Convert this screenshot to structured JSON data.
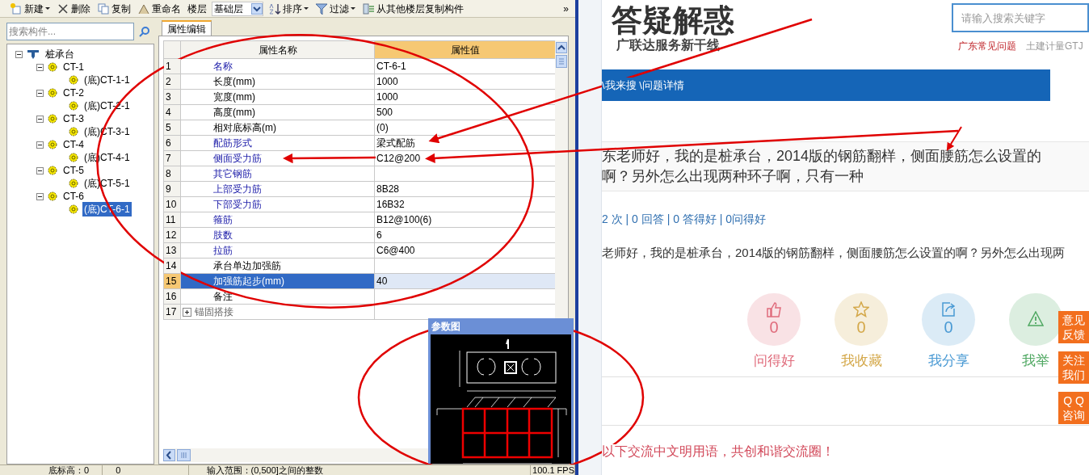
{
  "app": {
    "toolbar": [
      {
        "kind": "button",
        "label": "新建",
        "caret": true
      },
      {
        "kind": "button",
        "label": "删除",
        "caret": false
      },
      {
        "kind": "button",
        "label": "复制",
        "caret": false
      },
      {
        "kind": "button",
        "label": "重命名",
        "caret": false
      },
      {
        "kind": "label",
        "label": "楼层"
      },
      {
        "kind": "dropdown",
        "label": "基础层"
      },
      {
        "kind": "button",
        "label": "排序",
        "caret": true
      },
      {
        "kind": "button",
        "label": "过滤",
        "caret": true
      },
      {
        "kind": "button",
        "label": "从其他楼层复制构件",
        "caret": false
      },
      {
        "kind": "more",
        "label": "»"
      }
    ],
    "search": {
      "placeholder": "搜索构件..."
    },
    "tree": [
      {
        "label": "桩承台",
        "expanded": true,
        "selected": false,
        "children": [
          {
            "label": "CT-1",
            "expanded": true,
            "selected": false,
            "children": [
              {
                "label": "(底)CT-1-1",
                "selected": false
              }
            ]
          },
          {
            "label": "CT-2",
            "expanded": true,
            "selected": false,
            "children": [
              {
                "label": "(底)CT-2-1",
                "selected": false
              }
            ]
          },
          {
            "label": "CT-3",
            "expanded": true,
            "selected": false,
            "children": [
              {
                "label": "(底)CT-3-1",
                "selected": false
              }
            ]
          },
          {
            "label": "CT-4",
            "expanded": true,
            "selected": false,
            "children": [
              {
                "label": "(底)CT-4-1",
                "selected": false
              }
            ]
          },
          {
            "label": "CT-5",
            "expanded": true,
            "selected": false,
            "children": [
              {
                "label": "(底)CT-5-1",
                "selected": false
              }
            ]
          },
          {
            "label": "CT-6",
            "expanded": true,
            "selected": false,
            "children": [
              {
                "label": "(底)CT-6-1",
                "selected": true
              }
            ]
          }
        ]
      }
    ],
    "tabs": [
      {
        "label": "属性编辑",
        "selected": true
      }
    ],
    "table": {
      "columns": [
        "属性名称",
        "属性值"
      ],
      "rows": [
        {
          "index": "1",
          "name": "名称",
          "value": "CT-6-1",
          "kind": "blue",
          "selected": false
        },
        {
          "index": "2",
          "name": "长度(mm)",
          "value": "1000",
          "kind": "plain",
          "selected": false
        },
        {
          "index": "3",
          "name": "宽度(mm)",
          "value": "1000",
          "kind": "plain",
          "selected": false
        },
        {
          "index": "4",
          "name": "高度(mm)",
          "value": "500",
          "kind": "plain",
          "selected": false
        },
        {
          "index": "5",
          "name": "相对底标高(m)",
          "value": "(0)",
          "kind": "plain",
          "selected": false
        },
        {
          "index": "6",
          "name": "配筋形式",
          "value": "梁式配筋",
          "kind": "blue",
          "selected": false
        },
        {
          "index": "7",
          "name": "侧面受力筋",
          "value": "C12@200",
          "kind": "blue",
          "selected": false
        },
        {
          "index": "8",
          "name": "其它钢筋",
          "kind": "blue",
          "selected": false
        },
        {
          "index": "9",
          "name": "上部受力筋",
          "value": "8B28",
          "kind": "blue",
          "selected": false
        },
        {
          "index": "10",
          "name": "下部受力筋",
          "value": "16B32",
          "kind": "blue",
          "selected": false
        },
        {
          "index": "11",
          "name": "箍筋",
          "value": "B12@100(6)",
          "kind": "blue",
          "selected": false
        },
        {
          "index": "12",
          "name": "肢数",
          "value": "6",
          "kind": "blue",
          "selected": false
        },
        {
          "index": "13",
          "name": "拉筋",
          "value": "C6@400",
          "kind": "blue",
          "selected": false
        },
        {
          "index": "14",
          "name": "承台单边加强筋",
          "kind": "plain",
          "selected": false
        },
        {
          "index": "15",
          "name": "加强筋起步(mm)",
          "value": "40",
          "kind": "plain",
          "selected": true
        },
        {
          "index": "16",
          "name": "备注",
          "kind": "plain",
          "selected": false
        },
        {
          "index": "17",
          "name": "锚固搭接",
          "kind": "group",
          "expanded": false,
          "selected": false
        }
      ]
    },
    "diagram_panel": {
      "title": "参数图"
    },
    "status_bar": [
      "底标高：0",
      "0",
      "输入范围：(0,500]之间的整数",
      "100.1 FPS"
    ]
  },
  "web": {
    "logo": {
      "title": "答疑解惑",
      "subtitle": "广联达服务新干线"
    },
    "search": {
      "placeholder": "请输入搜索关键字"
    },
    "header_links": [
      {
        "label": "广东常见问题",
        "kind": "hot"
      },
      {
        "label": "土建计量GTJ",
        "kind": "normal"
      }
    ],
    "breadcrumb": "\\我来搜 \\问题详情",
    "question_title": "东老师好，我的是桩承台，2014版的钢筋翻样，侧面腰筋怎么设置的啊？另外怎么出现两种环子啊，只有一种",
    "stats": "2 次 | 0 回答 | 0 答得好 | 0问得好",
    "question_body": "老师好，我的是桩承台，2014版的钢筋翻样，侧面腰筋怎么设置的啊？另外怎么出现两",
    "actions": [
      {
        "count": "0",
        "label": "问得好",
        "color": "#e06c7c"
      },
      {
        "count": "0",
        "label": "我收藏",
        "color": "#d4a84a"
      },
      {
        "count": "0",
        "label": "我分享",
        "color": "#4a9ad4"
      },
      {
        "label": "我举",
        "color": "#4fa862"
      }
    ],
    "side_buttons": [
      "意见反馈",
      "关注我们",
      "Q Q咨询"
    ],
    "notice": "以下交流中文明用语，共创和谐交流圈！"
  }
}
